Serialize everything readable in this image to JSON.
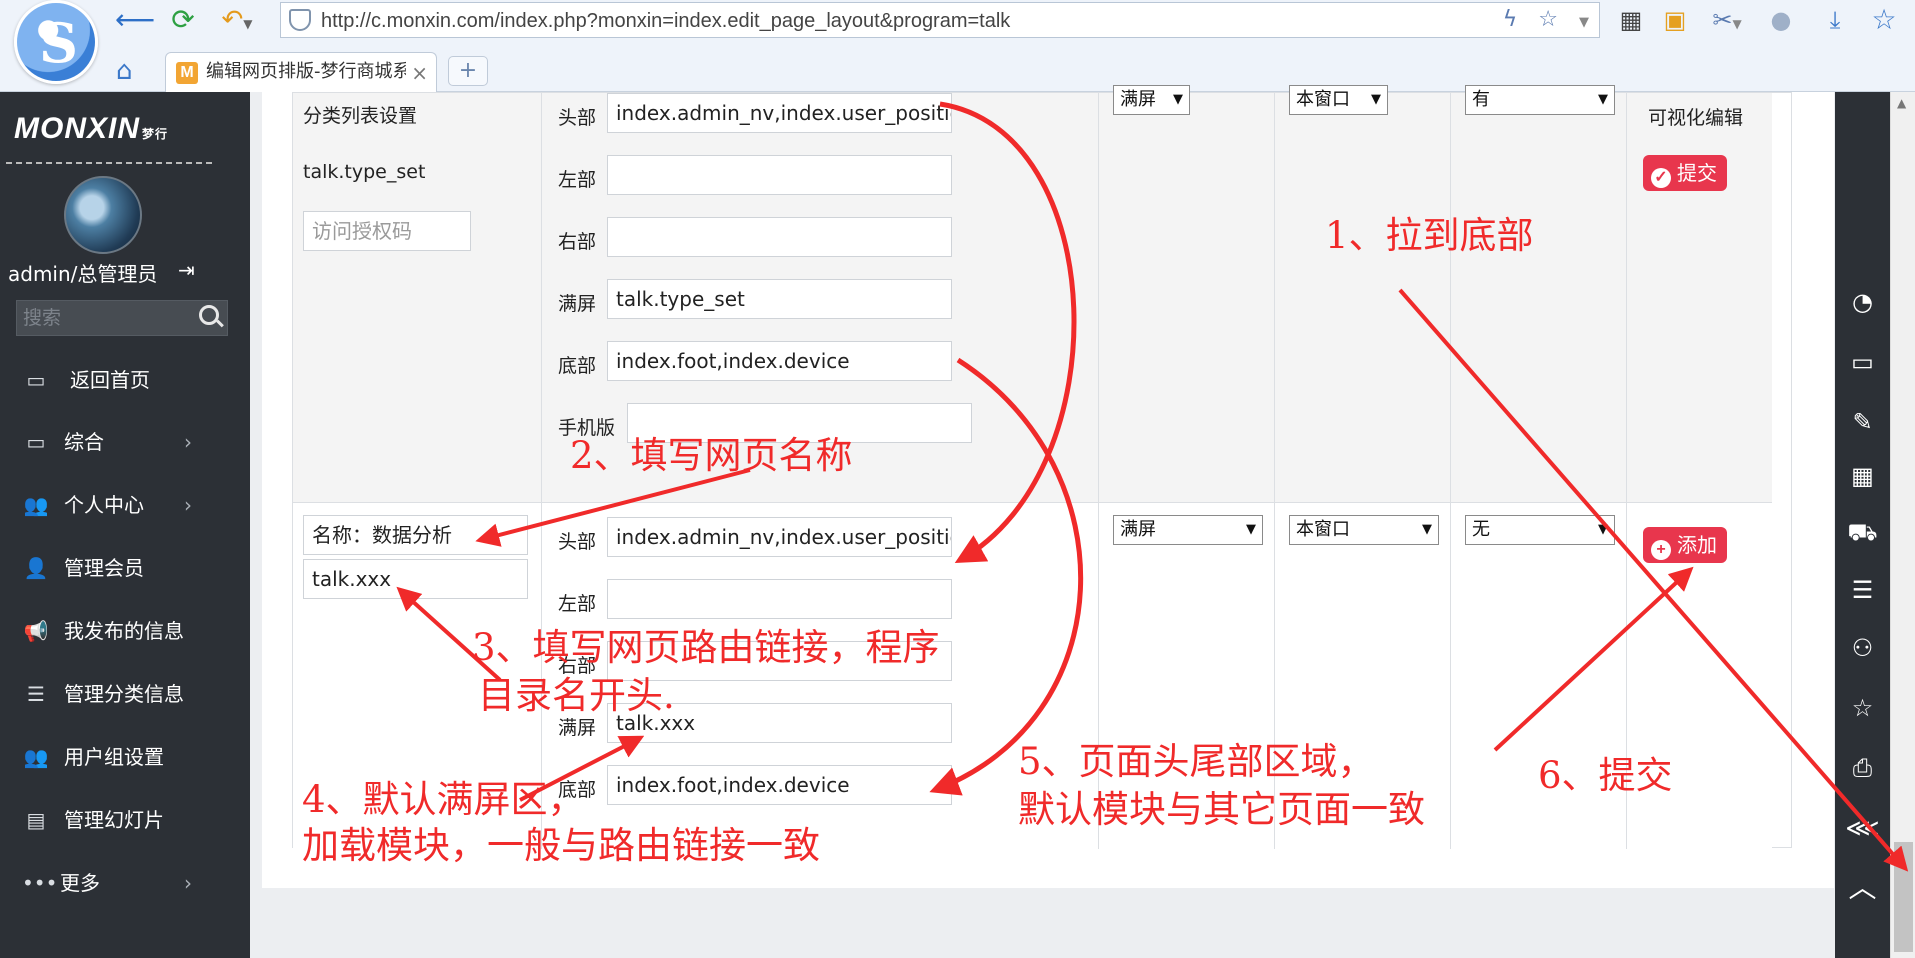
{
  "browser": {
    "url": "http://c.monxin.com/index.php?monxin=index.edit_page_layout&program=talk",
    "tab_title": "编辑网页排版-梦行商城系统",
    "logo_letter": "S",
    "tab_favicon": "M",
    "tab_close": "×",
    "new_tab": "+"
  },
  "sidebar": {
    "brand": "MONXIN",
    "brand_sub": "梦行",
    "username": "admin/总管理员",
    "search_placeholder": "搜索",
    "items": [
      {
        "label": "返回首页",
        "icon": "monitor-icon"
      },
      {
        "label": "综合",
        "icon": "monitor-icon",
        "arrow": "›"
      },
      {
        "label": "个人中心",
        "icon": "users-icon",
        "arrow": "›"
      },
      {
        "label": "管理会员",
        "icon": "user-icon"
      },
      {
        "label": "我发布的信息",
        "icon": "megaphone-icon"
      },
      {
        "label": "管理分类信息",
        "icon": "list-icon"
      },
      {
        "label": "用户组设置",
        "icon": "group-icon"
      },
      {
        "label": "管理幻灯片",
        "icon": "slides-icon"
      },
      {
        "label": "更多",
        "icon": "more-icon",
        "arrow": "›"
      }
    ]
  },
  "row1": {
    "title": "分类列表设置",
    "route": "talk.type_set",
    "auth_placeholder": "访问授权码",
    "labels": {
      "head": "头部",
      "left": "左部",
      "right": "右部",
      "full": "满屏",
      "foot": "底部",
      "mobile": "手机版"
    },
    "head": "index.admin_nv,index.user_position",
    "left": "",
    "right": "",
    "full": "talk.type_set",
    "foot": "index.foot,index.device",
    "mobile": "",
    "layout_select": "满屏",
    "target_select": "本窗口",
    "has_select": "有",
    "visual_edit": "可视化编辑",
    "submit_label": "提交"
  },
  "row2": {
    "name_value": "名称：数据分析",
    "route_value": "talk.xxx",
    "labels": {
      "head": "头部",
      "left": "左部",
      "right": "右部",
      "full": "满屏",
      "foot": "底部"
    },
    "head": "index.admin_nv,index.user_position",
    "left": "",
    "right": "",
    "full": "talk.xxx",
    "foot": "index.foot,index.device",
    "layout_select": "满屏",
    "target_select": "本窗口",
    "has_select": "无",
    "add_label": "添加"
  },
  "annotations": {
    "a1": "1、拉到底部",
    "a2": "2、填写网页名称",
    "a3_line1": "3、填写网页路由链接，程序",
    "a3_line2": "目录名开头.",
    "a4_line1": "4、默认满屏区，",
    "a4_line2": "加载模块，一般与路由链接一致",
    "a5_line1": "5、页面头尾部区域，",
    "a5_line2": "默认模块与其它页面一致",
    "a6": "6、提交"
  },
  "colors": {
    "sidebar_bg": "#2c3036",
    "accent_red": "#e8364d",
    "annotation_red": "#f02a2a"
  }
}
